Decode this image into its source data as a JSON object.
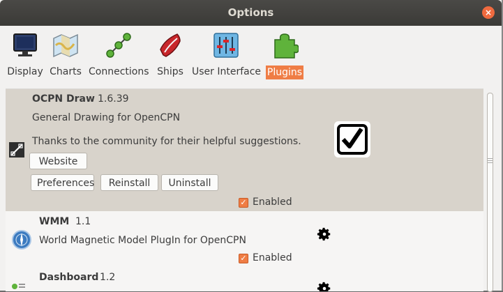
{
  "window": {
    "title": "Options",
    "close_label": "×"
  },
  "toolbar": {
    "items": [
      {
        "label": "Display",
        "icon": "monitor-icon"
      },
      {
        "label": "Charts",
        "icon": "chart-map-icon"
      },
      {
        "label": "Connections",
        "icon": "connections-icon"
      },
      {
        "label": "Ships",
        "icon": "ship-icon"
      },
      {
        "label": "User Interface",
        "icon": "sliders-icon"
      },
      {
        "label": "Plugins",
        "icon": "puzzle-icon",
        "active": true
      }
    ]
  },
  "plugins": [
    {
      "name": "OCPN Draw",
      "version": "1.6.39",
      "description": "General Drawing for OpenCPN",
      "details": "Thanks to the community for their helpful suggestions.",
      "website_label": "Website",
      "preferences_label": "Preferences",
      "reinstall_label": "Reinstall",
      "uninstall_label": "Uninstall",
      "enabled_label": "Enabled",
      "enabled": true,
      "status_icon": "checkbox-checked-icon"
    },
    {
      "name": "WMM",
      "version": "1.1",
      "description": "World Magnetic Model PlugIn for OpenCPN",
      "enabled_label": "Enabled",
      "enabled": true,
      "status_icon": "gear-icon"
    },
    {
      "name": "Dashboard",
      "version": "1.2",
      "status_icon": "gear-icon"
    }
  ],
  "colors": {
    "accent": "#ef7d45",
    "titlebar": "#3b3a37",
    "selected_row": "#d8d3cb"
  }
}
